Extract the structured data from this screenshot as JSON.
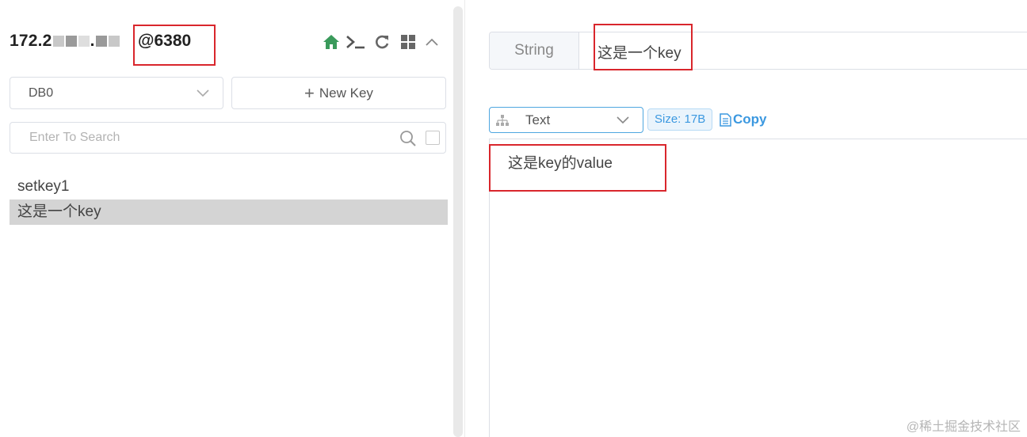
{
  "connection": {
    "title_prefix": "172.2",
    "title_mid": ".",
    "port": "@6380"
  },
  "toolbar": {
    "icons": [
      "home-icon",
      "terminal-icon",
      "refresh-icon",
      "grid-icon",
      "chevron-up-icon"
    ]
  },
  "db_select": {
    "value": "DB0"
  },
  "new_key_button": {
    "label": "New Key"
  },
  "search": {
    "placeholder": "Enter To Search"
  },
  "keys": [
    {
      "name": "setkey1",
      "selected": false
    },
    {
      "name": "这是一个key",
      "selected": true
    }
  ],
  "key_detail": {
    "type": "String",
    "name": "这是一个key",
    "format": "Text",
    "size": "Size: 17B",
    "copy_label": "Copy",
    "value": "这是key的value"
  },
  "watermark": "@稀土掘金技术社区",
  "colors": {
    "highlight_box": "#d9262c",
    "accent": "#3b98e0",
    "home_icon": "#3a9a5b",
    "selected_row": "#d4d4d4"
  }
}
